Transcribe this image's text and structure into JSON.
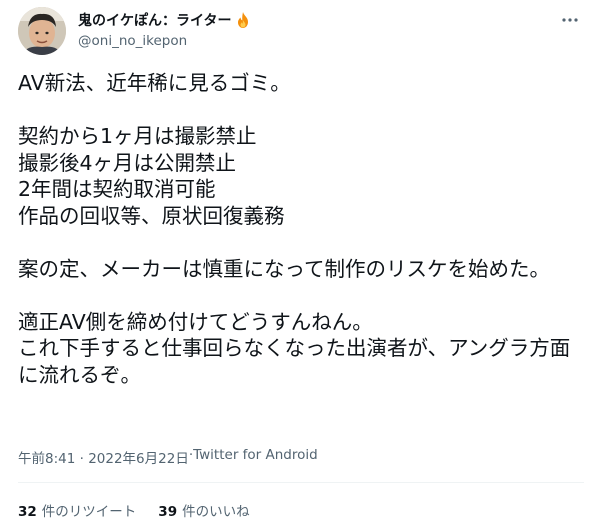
{
  "author": {
    "display_name": "鬼のイケぽん：ライター",
    "handle": "@oni_no_ikepon",
    "badge_icon": "fire-icon"
  },
  "tweet": {
    "text": "AV新法、近年稀に見るゴミ。\n\n契約から1ヶ月は撮影禁止\n撮影後4ヶ月は公開禁止\n2年間は契約取消可能\n作品の回収等、原状回復義務\n\n案の定、メーカーは慎重になって制作のリスケを始めた。\n\n適正AV側を締め付けてどうすんねん。\nこれ下手すると仕事回らなくなった出演者が、アングラ方面に流れるぞ。"
  },
  "meta": {
    "time": "午前8:41",
    "separator": " · ",
    "date": "2022年6月22日",
    "source": "Twitter for Android"
  },
  "stats": {
    "retweets_count": "32",
    "retweets_label": "件のリツイート",
    "likes_count": "39",
    "likes_label": "件のいいね"
  },
  "colors": {
    "text_primary": "#0f1419",
    "text_secondary": "#536471",
    "divider": "#eff3f4"
  }
}
